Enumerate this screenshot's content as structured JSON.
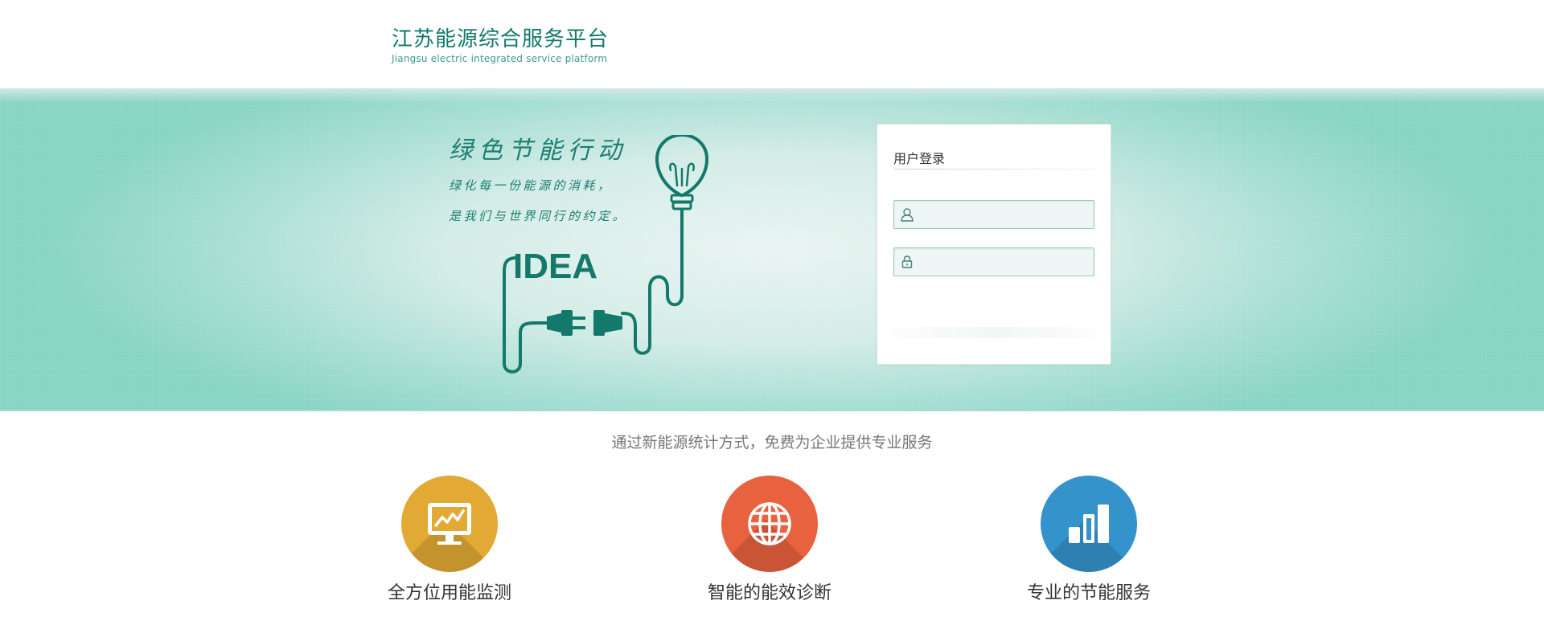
{
  "header": {
    "title": "江苏能源综合服务平台",
    "subtitle": "Jiangsu electric integrated service platform"
  },
  "banner": {
    "slogan_title": "绿色节能行动",
    "slogan_line1": "绿化每一份能源的消耗，",
    "slogan_line2": "是我们与世界同行的约定。",
    "idea_text": "IDEA"
  },
  "login": {
    "title": "用户登录",
    "username_value": "",
    "password_value": ""
  },
  "tagline": "通过新能源统计方式，免费为企业提供专业服务",
  "features": [
    {
      "label": "全方位用能监测",
      "icon": "monitor-chart-icon",
      "color": "#e2a935"
    },
    {
      "label": "智能的能效诊断",
      "icon": "globe-icon",
      "color": "#e9623f"
    },
    {
      "label": "专业的节能服务",
      "icon": "bar-chart-icon",
      "color": "#3593cb"
    }
  ]
}
